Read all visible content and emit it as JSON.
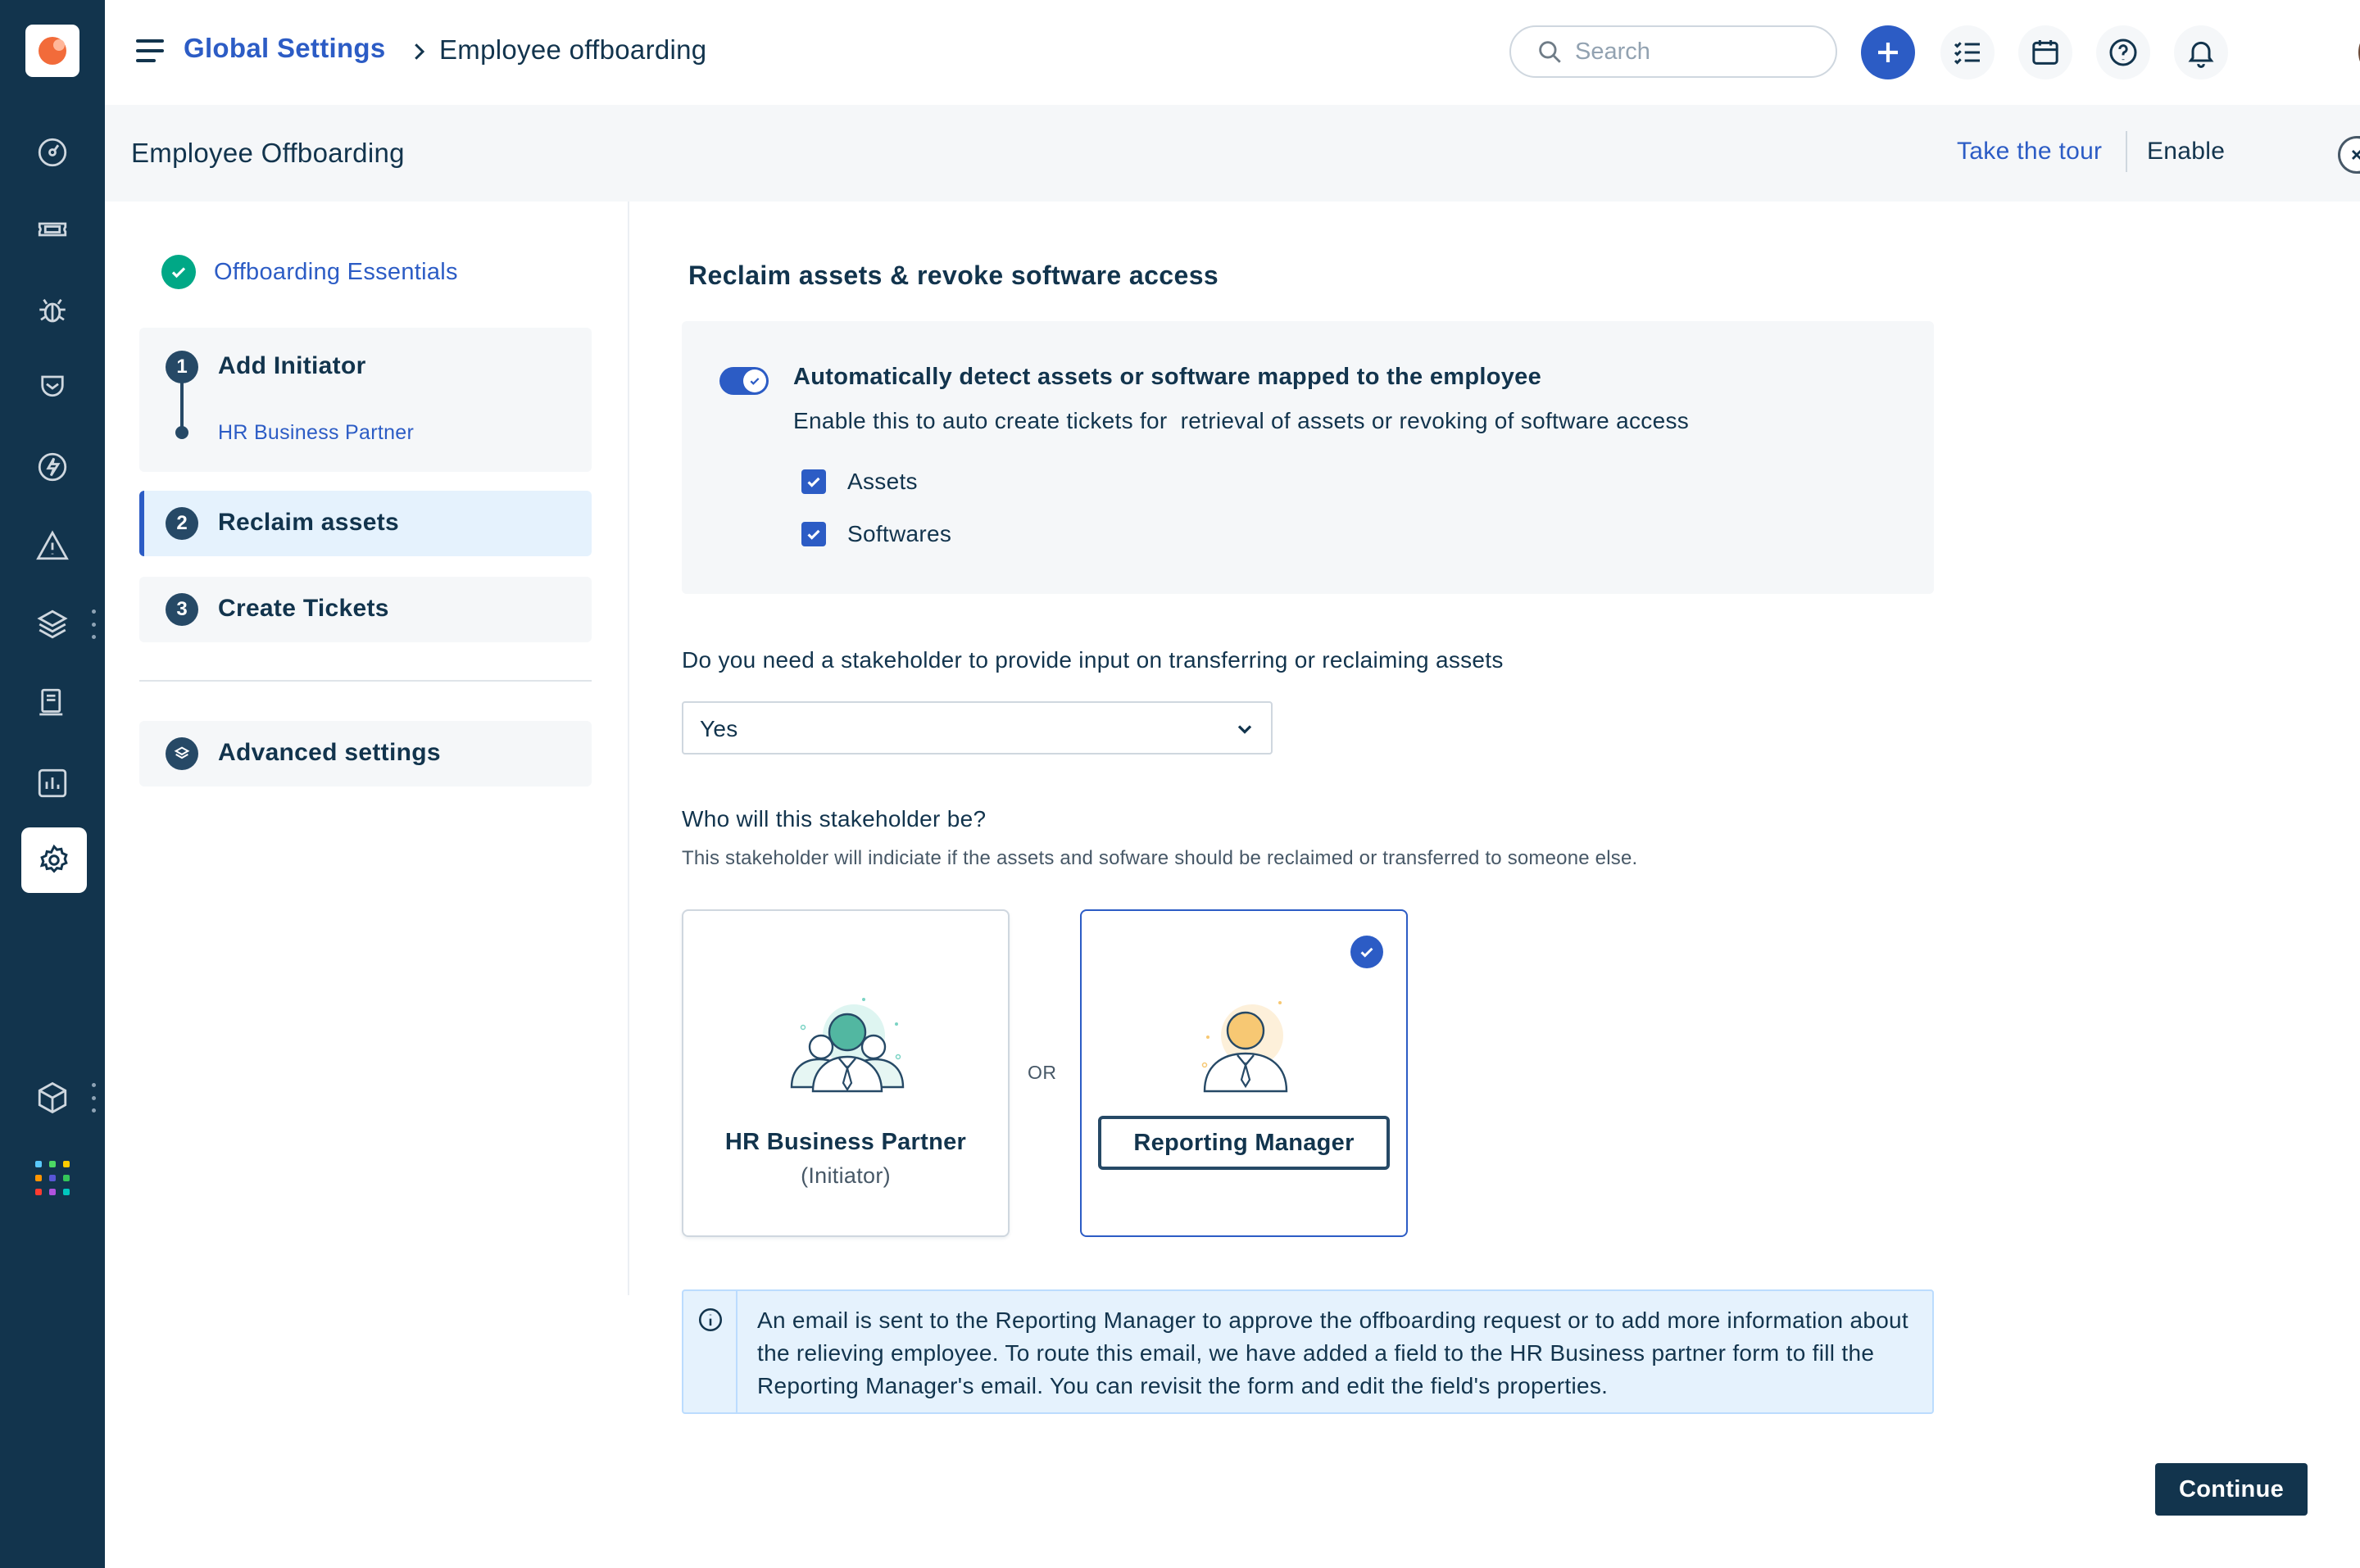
{
  "topbar": {
    "breadcrumb_parent": "Global Settings",
    "breadcrumb_current": "Employee offboarding",
    "search_placeholder": "Search"
  },
  "header": {
    "title": "Employee Offboarding",
    "tour_link": "Take the tour",
    "enable_label": "Enable",
    "enabled": false
  },
  "sidebar": {
    "icons": [
      "dashboard-icon",
      "tickets-icon",
      "problems-icon",
      "changes-icon",
      "releases-icon",
      "alerts-icon",
      "assets-icon",
      "solutions-icon",
      "reports-icon",
      "admin-settings-icon",
      "modules-icon",
      "apps-icon"
    ],
    "active": "admin-settings-icon"
  },
  "steps": {
    "essentials": "Offboarding Essentials",
    "items": [
      {
        "number": "1",
        "label": "Add Initiator",
        "sub": "HR Business Partner"
      },
      {
        "number": "2",
        "label": "Reclaim assets"
      },
      {
        "number": "3",
        "label": "Create Tickets"
      }
    ],
    "advanced": "Advanced settings"
  },
  "main": {
    "section_title": "Reclaim assets & revoke software access",
    "auto_detect": {
      "title": "Automatically detect assets or software mapped to the employee",
      "description": "Enable this to auto create tickets for  retrieval of assets or revoking of software access",
      "enabled": true,
      "options": [
        {
          "label": "Assets",
          "checked": true
        },
        {
          "label": "Softwares",
          "checked": true
        }
      ]
    },
    "stakeholder_question": "Do you need a stakeholder to provide input on transferring or reclaiming assets",
    "stakeholder_select": "Yes",
    "who_question": "Who will this stakeholder be?",
    "who_help": "This stakeholder will indiciate if the assets and sofware should be reclaimed or transferred to someone else.",
    "choices": [
      {
        "label": "HR Business Partner",
        "sub": "(Initiator)",
        "selected": false
      },
      {
        "label": "Reporting Manager",
        "selected": true
      }
    ],
    "or_label": "OR",
    "info_text": "An email is sent to the Reporting Manager to approve the offboarding request or to add more information about the relieving employee. To route this email, we have added a field to the HR Business partner form to fill the Reporting Manager's email. You can revisit the form and edit the field's properties.",
    "continue_label": "Continue"
  },
  "colors": {
    "rail": "#12344d",
    "accent": "#2c5cc5",
    "success": "#00a886",
    "info_bg": "#e5f2fd"
  }
}
